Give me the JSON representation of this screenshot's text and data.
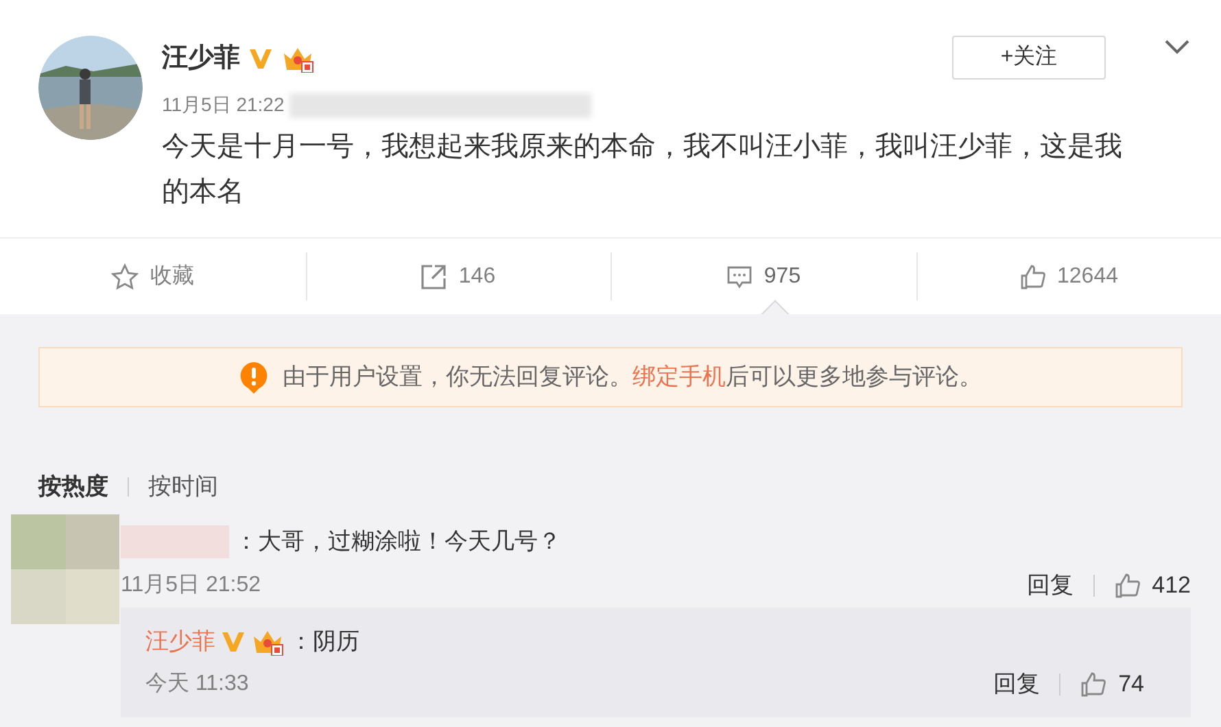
{
  "post": {
    "author": "汪少菲",
    "verified": true,
    "follow_button": "+关注",
    "time": "11月5日 21:22",
    "text": "今天是十月一号，我想起来我原来的本命，我不叫汪小菲，我叫汪少菲，这是我的本名"
  },
  "actions": [
    {
      "kind": "star",
      "label": "收藏",
      "selected": false
    },
    {
      "kind": "share",
      "label": "146",
      "selected": false
    },
    {
      "kind": "comment",
      "label": "975",
      "selected": true
    },
    {
      "kind": "like",
      "label": "12644",
      "selected": false
    }
  ],
  "notice": {
    "before": "由于用户设置，你无法回复评论。",
    "link": "绑定手机",
    "after": "后可以更多地参与评论。"
  },
  "sort_tabs": [
    {
      "label": "按热度",
      "selected": true
    },
    {
      "label": "按时间",
      "selected": false
    }
  ],
  "comments": [
    {
      "text": "：大哥，过糊涂啦！今天几号？",
      "time": "11月5日 21:52",
      "reply_label": "回复",
      "likes": "412",
      "replies": [
        {
          "author": "汪少菲",
          "verified": true,
          "text": "：阴历",
          "time": "今天 11:33",
          "reply_label": "回复",
          "likes": "74"
        }
      ]
    }
  ]
}
